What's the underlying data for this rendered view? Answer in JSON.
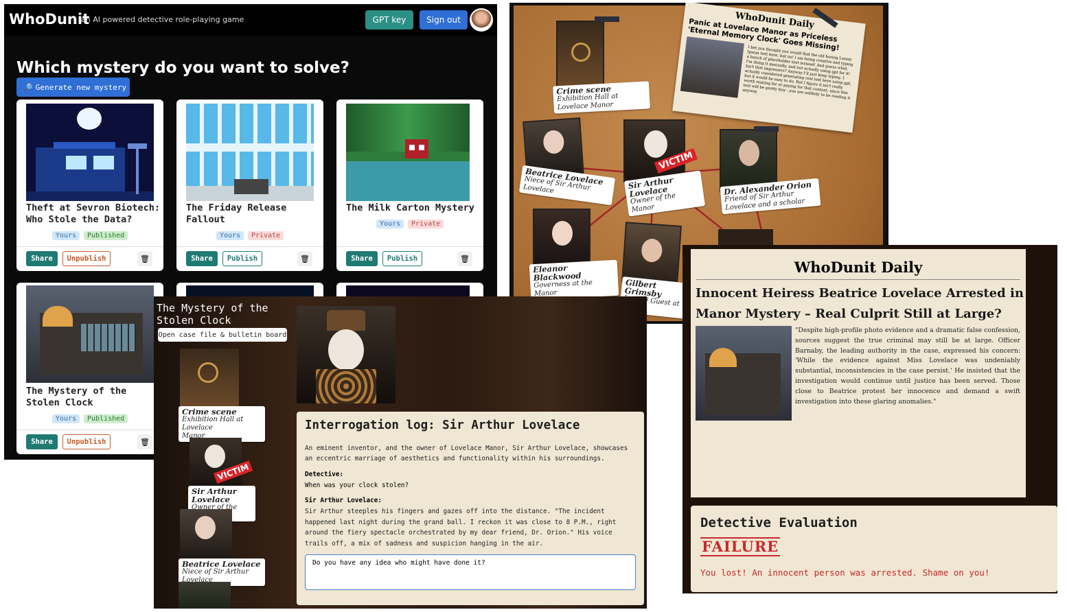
{
  "app": {
    "logo": "WhoDunit",
    "tagline": "an AI powered detective role-playing game",
    "gpt_key_label": "GPT key",
    "sign_out_label": "Sign out",
    "colors": {
      "accent_teal": "#2b8f86",
      "accent_blue": "#2f6fd6",
      "victim_red": "#d8242a"
    }
  },
  "picker": {
    "heading": "Which mystery do you want to solve?",
    "generate_label": "Generate new mystery",
    "generate_icon": "magnifier-icon",
    "cards": [
      {
        "title_1": "Theft at Sevron Biotech:",
        "title_2": "Who Stole the Data?",
        "badge_owner": "Yours",
        "badge_status": "Published",
        "share": "Share",
        "action": "Unpublish",
        "delete_icon": "trash-icon"
      },
      {
        "title_1": "The Friday Release",
        "title_2": "Fallout",
        "badge_owner": "Yours",
        "badge_status": "Private",
        "share": "Share",
        "action": "Publish",
        "delete_icon": "trash-icon"
      },
      {
        "title_1": "The Milk Carton Mystery",
        "title_2": "",
        "badge_owner": "Yours",
        "badge_status": "Private",
        "share": "Share",
        "action": "Publish",
        "delete_icon": "trash-icon"
      },
      {
        "title_1": "The Mystery of the",
        "title_2": "Stolen Clock",
        "badge_owner": "Yours",
        "badge_status": "Published",
        "share": "Share",
        "action": "Unpublish",
        "delete_icon": "trash-icon"
      }
    ]
  },
  "board": {
    "newspaper": {
      "masthead": "WhoDunit Daily",
      "headline": "Panic at Lovelace Manor as Priceless 'Eternal Memory Clock' Goes Missing!",
      "body": "I bet you thought you would find the old boring Lorem Ipsum text here, but no! I am being creative and typing a bunch of placeholder text instead! And guess what, I'm doing it manually, and not actually using gpt for it! Isn't that impressive? Anyway I'll just keep typing. I actually considered generating real text here using gpt, but it would be easy to do. But I figure it isn't really worth waiting for or paying for that content, since this text will be pretty tiny - you are unlikely to be reading it anyway."
    },
    "pins": [
      {
        "name": "Crime scene",
        "role": "Exhibition Hall at Lovelace Manor"
      },
      {
        "name": "Beatrice Lovelace",
        "role": "Niece of Sir Arthur Lovelace"
      },
      {
        "name": "Sir Arthur Lovelace",
        "role": "Owner of the Manor"
      },
      {
        "name": "Dr. Alexander Orion",
        "role": "Friend of Sir Arthur Lovelace and a scholar"
      },
      {
        "name": "Eleanor Blackwood",
        "role": "Governess at the Manor"
      },
      {
        "name": "Gilbert Grimsby",
        "role": "Invited Guest at M"
      }
    ],
    "victim_stamp": "VICTIM"
  },
  "interrogation": {
    "case_title_1": "The Mystery of the",
    "case_title_2": "Stolen Clock",
    "open_case_label": "Open case file & bulletin board",
    "side_cards": [
      {
        "name": "Crime scene",
        "role_1": "Exhibition Hall at Lovelace",
        "role_2": "Manor"
      },
      {
        "name": "Sir Arthur Lovelace",
        "role_1": "Owner of the Manor",
        "role_2": ""
      },
      {
        "name": "Beatrice Lovelace",
        "role_1": "Niece of Sir Arthur Lovelace",
        "role_2": ""
      }
    ],
    "victim_stamp": "VICTIM",
    "log_title": "Interrogation log: Sir Arthur Lovelace",
    "intro": "An eminent inventor, and the owner of Lovelace Manor, Sir Arthur Lovelace, showcases an eccentric marriage of aesthetics and functionality within his surroundings.",
    "detective_label": "Detective:",
    "detective_q": "When was your clock stolen?",
    "suspect_label": "Sir Arthur Lovelace:",
    "answer": "Sir Arthur steeples his fingers and gazes off into the distance. \"The incident happened last night during the grand ball. I reckon it was close to 8 P.M., right around the fiery spectacle orchestrated by my dear friend, Dr. Orion.\" His voice trails off, a mix of sadness and suspicion hanging in the air.",
    "input_value": "Do you have any idea who might have done it?"
  },
  "result": {
    "masthead": "WhoDunit Daily",
    "headline": "Innocent Heiress Beatrice Lovelace Arrested in Manor Mystery – Real Culprit Still at Large?",
    "body": "\"Despite high-profile photo evidence and a dramatic false confession, sources suggest the true criminal may still be at large. Officer Barnaby, the leading authority in the case, expressed his concern: 'While the evidence against Miss Lovelace was undeniably substantial, inconsistencies in the case persist.' He insisted that the investigation would continue until justice has been served. Those close to Beatrice protest her innocence and demand a swift investigation into these glaring anomalies.\"",
    "eval_title": "Detective Evaluation",
    "stamp": "FAILURE",
    "outcome": "You lost! An innocent person was arrested. Shame on you!"
  }
}
